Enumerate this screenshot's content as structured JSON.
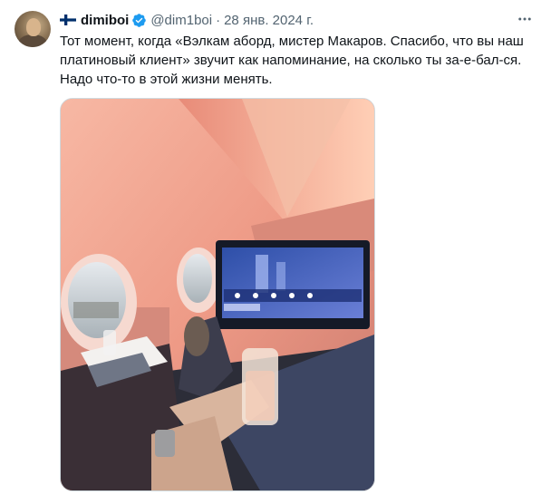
{
  "author": {
    "display_name": "dimiboi",
    "handle": "@dim1boi",
    "flag_icon": "finland-flag-icon",
    "verified_icon": "verified-badge-icon"
  },
  "tweet": {
    "separator": "·",
    "date": "28 янв. 2024 г.",
    "text": "Тот момент, когда «Вэлкам аборд, мистер Макаров. Спасибо, что вы наш платиновый клиент» звучит как напоминание, на сколько ты за-е-бал-ся. Надо что-то в этой жизни менять."
  },
  "colors": {
    "accent_blue": "#1d9bf0",
    "text_primary": "#0f1419",
    "text_secondary": "#536471",
    "border": "#cfd9de"
  }
}
